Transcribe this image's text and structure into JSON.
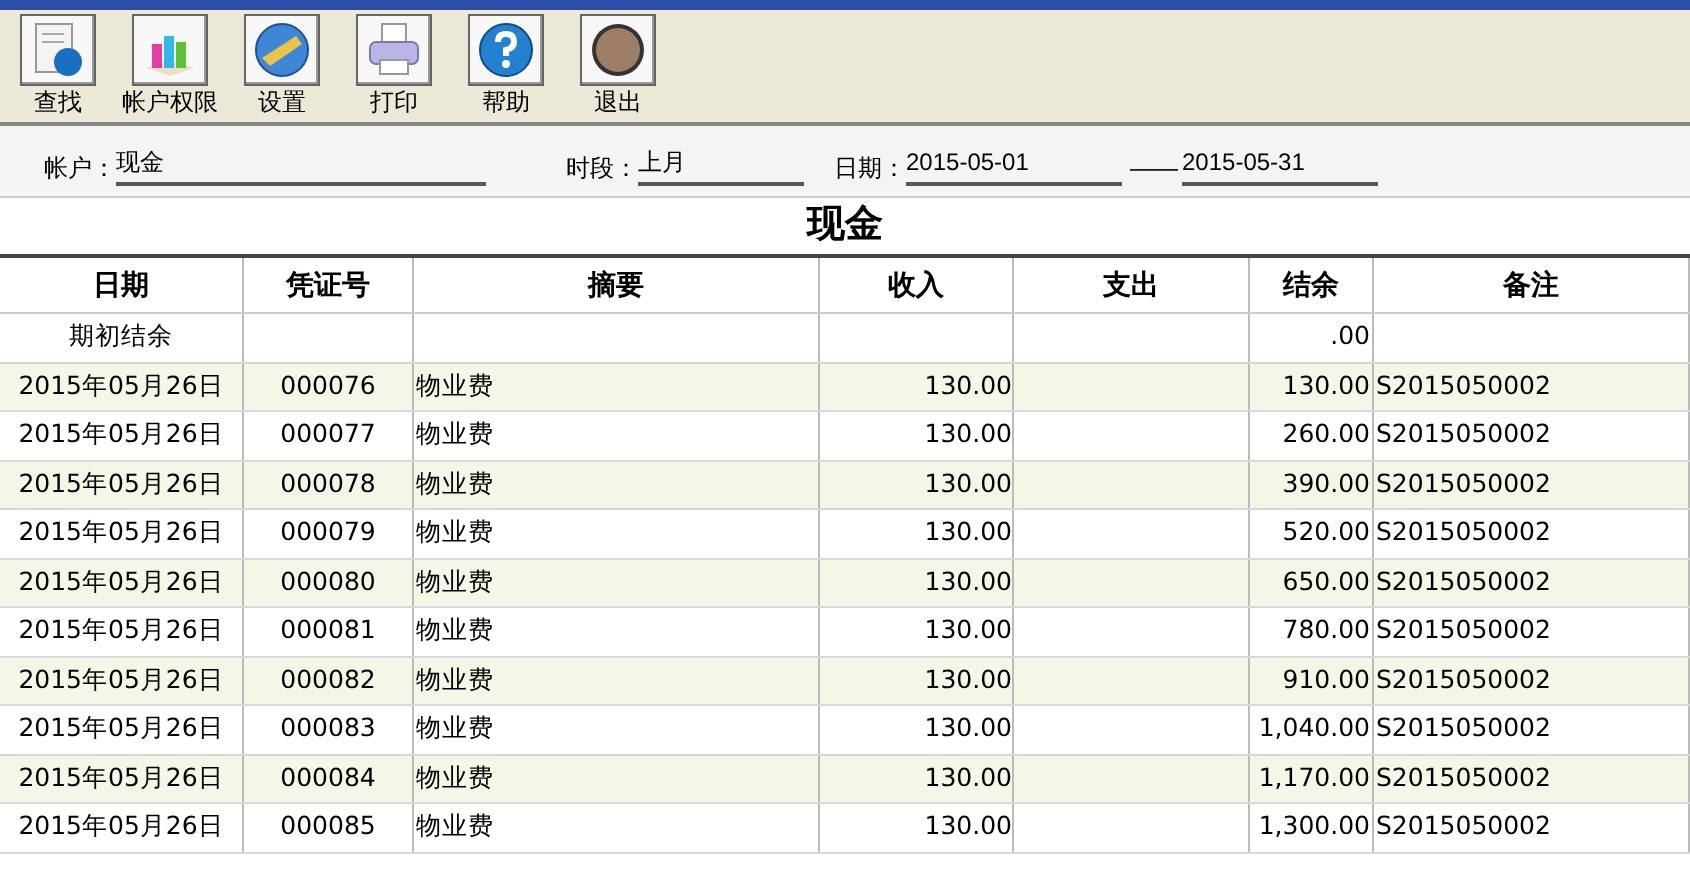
{
  "toolbar": [
    {
      "label": "查找",
      "kind": "find"
    },
    {
      "label": "帐户权限",
      "kind": "rights"
    },
    {
      "label": "设置",
      "kind": "settings"
    },
    {
      "label": "打印",
      "kind": "print"
    },
    {
      "label": "帮助",
      "kind": "help"
    },
    {
      "label": "退出",
      "kind": "exit"
    }
  ],
  "filters": {
    "account": {
      "label": "帐户：",
      "value": "现金"
    },
    "period": {
      "label": "时段：",
      "value": "上月"
    },
    "date": {
      "label": "日期：",
      "from": "2015-05-01",
      "separator": "——",
      "to": "2015-05-31"
    }
  },
  "table": {
    "title": "现金",
    "columns": [
      "日期",
      "凭证号",
      "摘要",
      "收入",
      "支出",
      "结余",
      "备注"
    ],
    "rows": [
      [
        "期初结余",
        "",
        "",
        "",
        "",
        ".00",
        ""
      ],
      [
        "2015年05月26日",
        "000076",
        "物业费",
        "130.00",
        "",
        "130.00",
        "S2015050002"
      ],
      [
        "2015年05月26日",
        "000077",
        "物业费",
        "130.00",
        "",
        "260.00",
        "S2015050002"
      ],
      [
        "2015年05月26日",
        "000078",
        "物业费",
        "130.00",
        "",
        "390.00",
        "S2015050002"
      ],
      [
        "2015年05月26日",
        "000079",
        "物业费",
        "130.00",
        "",
        "520.00",
        "S2015050002"
      ],
      [
        "2015年05月26日",
        "000080",
        "物业费",
        "130.00",
        "",
        "650.00",
        "S2015050002"
      ],
      [
        "2015年05月26日",
        "000081",
        "物业费",
        "130.00",
        "",
        "780.00",
        "S2015050002"
      ],
      [
        "2015年05月26日",
        "000082",
        "物业费",
        "130.00",
        "",
        "910.00",
        "S2015050002"
      ],
      [
        "2015年05月26日",
        "000083",
        "物业费",
        "130.00",
        "",
        "1,040.00",
        "S2015050002"
      ],
      [
        "2015年05月26日",
        "000084",
        "物业费",
        "130.00",
        "",
        "1,170.00",
        "S2015050002"
      ],
      [
        "2015年05月26日",
        "000085",
        "物业费",
        "130.00",
        "",
        "1,300.00",
        "S2015050002"
      ]
    ]
  }
}
